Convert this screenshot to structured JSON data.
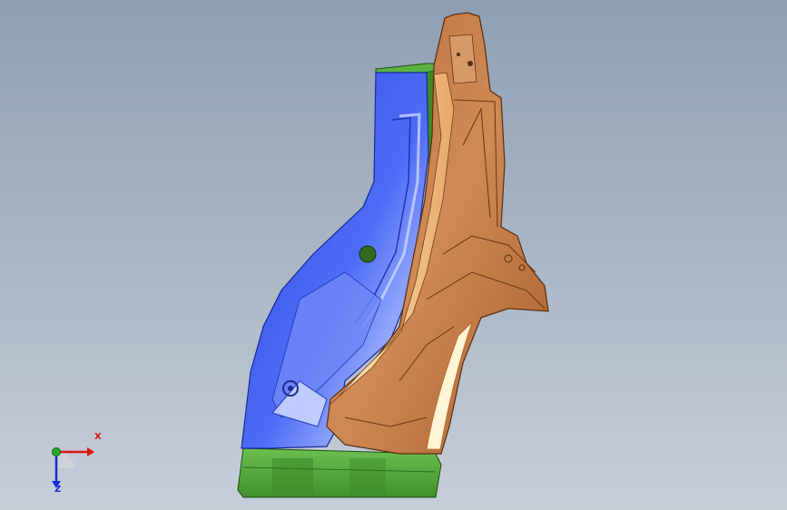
{
  "viewport": {
    "description_bg": "#a7b4c4"
  },
  "model": {
    "colors": {
      "blue_part": "#3d5cf0",
      "blue_highlight": "#b9c8ff",
      "orange_part": "#c9824e",
      "orange_light": "#f1c58c",
      "orange_dark": "#8a4b22",
      "green_part": "#4fa83a",
      "green_dark": "#2d6e1f",
      "hole": "#2f6b1f"
    }
  },
  "triad": {
    "x_label": "X",
    "z_label": "Z",
    "x_color": "#dd1111",
    "z_color": "#1b2bd6",
    "origin_color": "#22aa22"
  }
}
